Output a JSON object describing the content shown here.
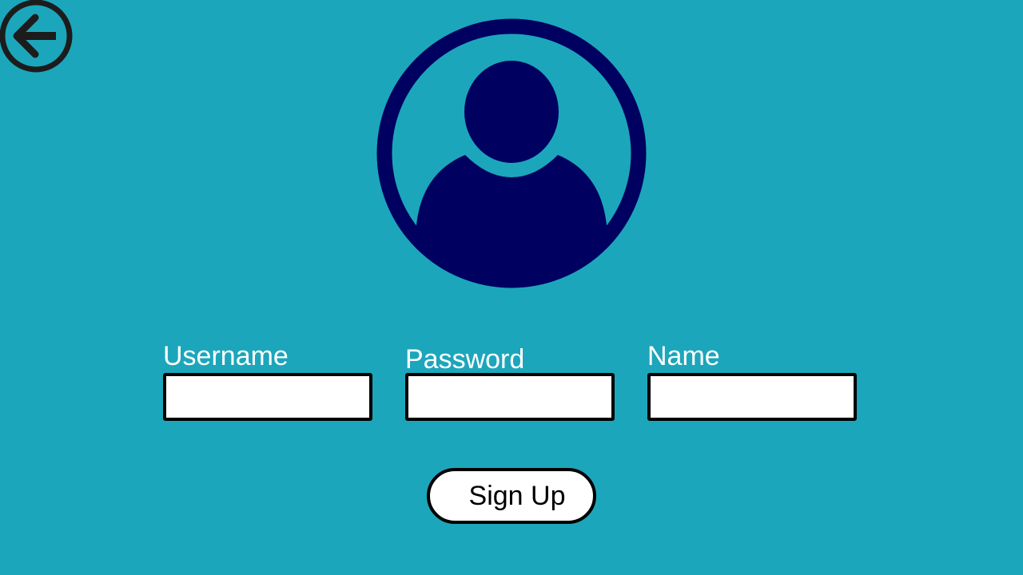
{
  "header": {
    "back_icon": "arrow-left-circle-icon"
  },
  "profile": {
    "avatar_icon": "user-avatar-icon",
    "avatar_color": "#000060"
  },
  "form": {
    "fields": [
      {
        "label": "Username",
        "value": "",
        "placeholder": ""
      },
      {
        "label": "Password",
        "value": "",
        "placeholder": ""
      },
      {
        "label": "Name",
        "value": "",
        "placeholder": ""
      }
    ],
    "submit_label": "Sign Up"
  },
  "theme": {
    "background": "#1ca6bb",
    "text": "#ffffff",
    "border": "#000000",
    "input_background": "#ffffff"
  }
}
